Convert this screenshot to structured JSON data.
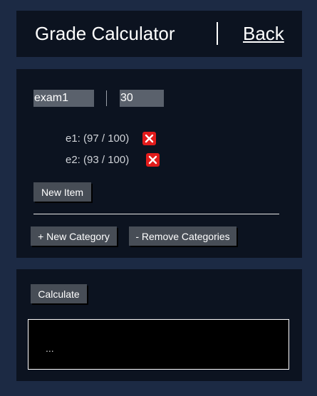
{
  "header": {
    "title": "Grade Calculator",
    "back_label": "Back"
  },
  "category": {
    "name_value": "exam1",
    "weight_value": "30",
    "items": [
      {
        "label": "e1: (97 / 100)"
      },
      {
        "label": "e2: (93 / 100)"
      }
    ],
    "new_item_label": "New Item",
    "new_category_label": "+ New Category",
    "remove_categories_label": "- Remove Categories"
  },
  "calculator": {
    "calculate_label": "Calculate",
    "output_text": "..."
  },
  "colors": {
    "background": "#1c2a44",
    "panel": "#0c1320",
    "delete_red": "#e21b1b",
    "button": "#474d56"
  },
  "icons": {
    "delete": "close-icon"
  }
}
